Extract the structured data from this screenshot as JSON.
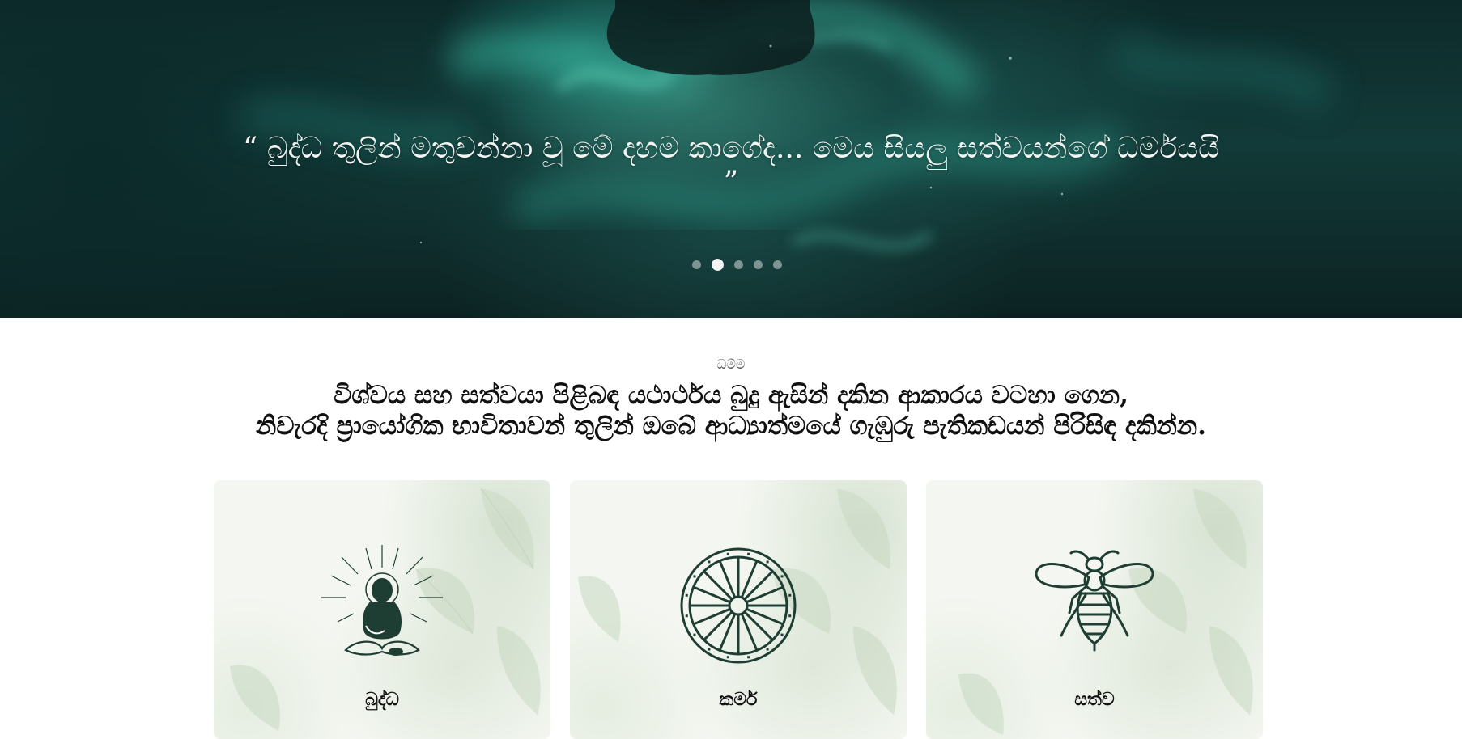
{
  "hero": {
    "quote": "“ බුද්ධ තුලින් මතුවන්නා වූ මේ දහම කාගේද... මෙය සියලු සත්වයන්ගේ ධර්මයයි ”",
    "slides": 5,
    "active_slide": 2
  },
  "section": {
    "eyebrow": "ධම්ම",
    "headline_line1": "විශ්වය සහ සත්වයා පිළිබඳ යථාර්ථය බුදු ඇසින් දකින ආකාරය වටහා ගෙන,",
    "headline_line2": "නිවැරදි ප්‍රායෝගික භාවිතාවන් තුලින් ඔබේ ආධ්‍යාත්මයේ ගැඹුරු පැතිකඩයන් පිරිසිඳ දකින්න."
  },
  "cards": [
    {
      "label": "බුද්ධ",
      "icon": "meditating-buddha-icon"
    },
    {
      "label": "කර්ම",
      "icon": "dharma-wheel-icon"
    },
    {
      "label": "සත්ව",
      "icon": "bee-icon"
    }
  ],
  "colors": {
    "icon_stroke": "#1e3d33",
    "hero_dark": "#0d2a2a",
    "hero_teal": "#2fae9b"
  }
}
